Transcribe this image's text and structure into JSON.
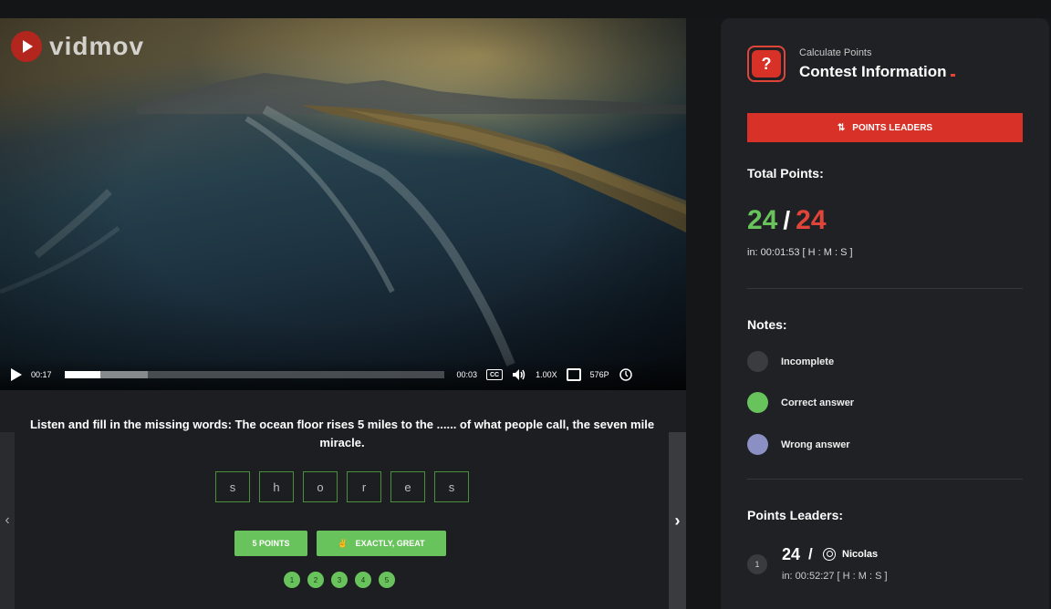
{
  "player": {
    "logo_text": "vidmov",
    "current_time": "00:17",
    "duration": "00:03",
    "progress": 0.095,
    "buffered": 0.22,
    "cc_label": "CC",
    "speed": "1.00X",
    "quality": "576P"
  },
  "question": {
    "text": "Listen and fill in the missing words: The ocean floor rises 5 miles to the ...... of what people call, the seven mile miracle.",
    "letters": [
      "s",
      "h",
      "o",
      "r",
      "e",
      "s"
    ],
    "points_button": "5 POINTS",
    "feedback_button": "EXACTLY, GREAT",
    "pages": [
      "1",
      "2",
      "3",
      "4",
      "5"
    ]
  },
  "panel": {
    "subtitle": "Calculate Points",
    "title": "Contest Information",
    "leaders_button": "POINTS LEADERS",
    "total_label": "Total Points:",
    "score_earned": "24",
    "score_total": "24",
    "time": "in: 00:01:53 [ H : M : S ]",
    "notes_label": "Notes:",
    "notes": [
      {
        "label": "Incomplete",
        "color": "#3b3c40"
      },
      {
        "label": "Correct answer",
        "color": "#69c35d"
      },
      {
        "label": "Wrong answer",
        "color": "#8a8fc4"
      }
    ],
    "leaders_label": "Points Leaders:",
    "leader": {
      "rank": "1",
      "points": "24",
      "name": "Nicolas",
      "time": "in: 00:52:27 [ H : M : S ]"
    }
  },
  "colors": {
    "accent_red": "#d83228",
    "accent_green": "#69c35d"
  }
}
